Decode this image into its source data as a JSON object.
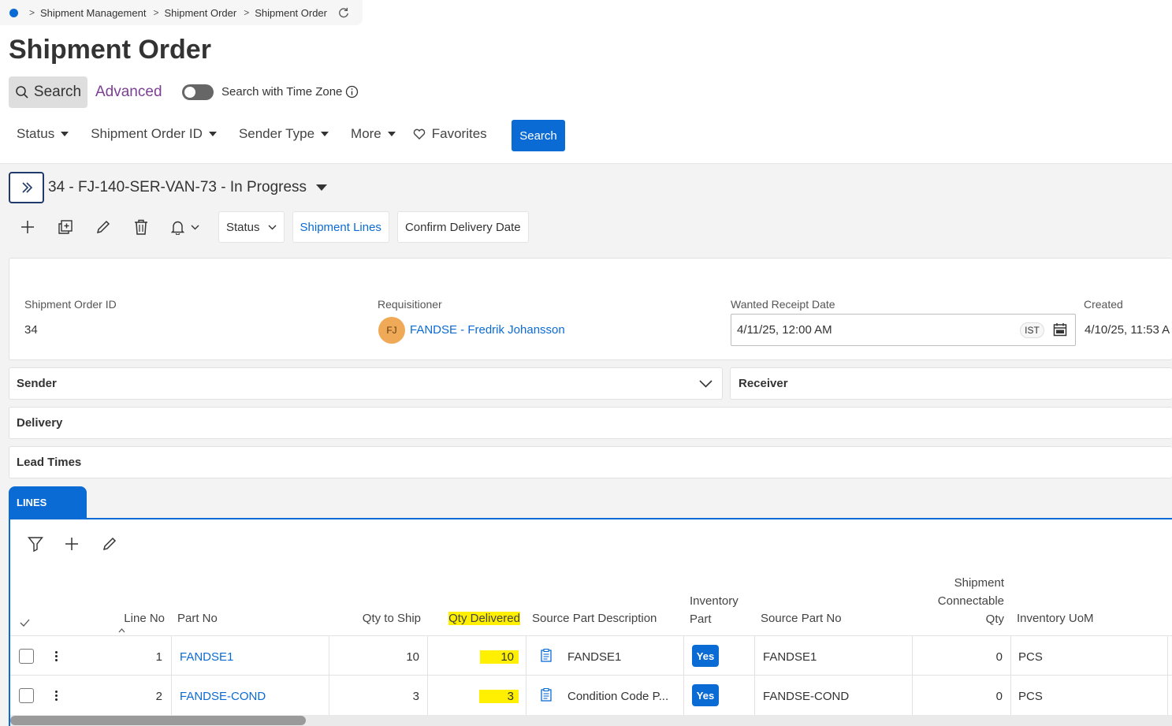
{
  "breadcrumb": [
    "Shipment Management",
    "Shipment Order",
    "Shipment Order"
  ],
  "page_title": "Shipment Order",
  "search": {
    "search_tab": "Search",
    "advanced": "Advanced",
    "time_zone_label": "Search with Time Zone",
    "time_zone_enabled": false
  },
  "filters": [
    "Status",
    "Shipment Order ID",
    "Sender Type",
    "More"
  ],
  "favorites": "Favorites",
  "search_button": "Search",
  "record": {
    "title": "34 - FJ-140-SER-VAN-73 - In Progress"
  },
  "commands": {
    "status": "Status",
    "shipment_lines": "Shipment Lines",
    "confirm_delivery_date": "Confirm Delivery Date"
  },
  "header_fields": {
    "shipment_order_id_label": "Shipment Order ID",
    "shipment_order_id": "34",
    "requisitioner_label": "Requisitioner",
    "requisitioner_initials": "FJ",
    "requisitioner": "FANDSE - Fredrik Johansson",
    "wanted_receipt_date_label": "Wanted Receipt Date",
    "wanted_receipt_date": "4/11/25, 12:00 AM",
    "time_zone": "IST",
    "created_label": "Created",
    "created": "4/10/25, 11:53 A"
  },
  "groups": {
    "sender": "Sender",
    "receiver": "Receiver",
    "delivery": "Delivery",
    "lead_times": "Lead Times"
  },
  "lines_tab": "LINES",
  "table": {
    "columns": {
      "line_no": "Line No",
      "part_no": "Part No",
      "qty_to_ship": "Qty to Ship",
      "qty_delivered": "Qty Delivered",
      "source_part_description": "Source Part Description",
      "inventory_part_1": "Inventory",
      "inventory_part_2": "Part",
      "source_part_no": "Source Part No",
      "shipment_connectable_1": "Shipment",
      "shipment_connectable_2": "Connectable",
      "shipment_connectable_3": "Qty",
      "inventory_uom": "Inventory UoM"
    },
    "rows": [
      {
        "line_no": "1",
        "part_no": "FANDSE1",
        "qty_to_ship": "10",
        "qty_delivered": "10",
        "description": "FANDSE1",
        "inventory_part": "Yes",
        "source_part_no": "FANDSE1",
        "connectable_qty": "0",
        "uom": "PCS"
      },
      {
        "line_no": "2",
        "part_no": "FANDSE-COND",
        "qty_to_ship": "3",
        "qty_delivered": "3",
        "description": "Condition Code P...",
        "inventory_part": "Yes",
        "source_part_no": "FANDSE-COND",
        "connectable_qty": "0",
        "uom": "PCS"
      }
    ]
  },
  "colors": {
    "primary": "#0b6bd4",
    "advanced_link": "#7b3f93",
    "highlight": "#ffef00",
    "avatar": "#f0a956"
  }
}
